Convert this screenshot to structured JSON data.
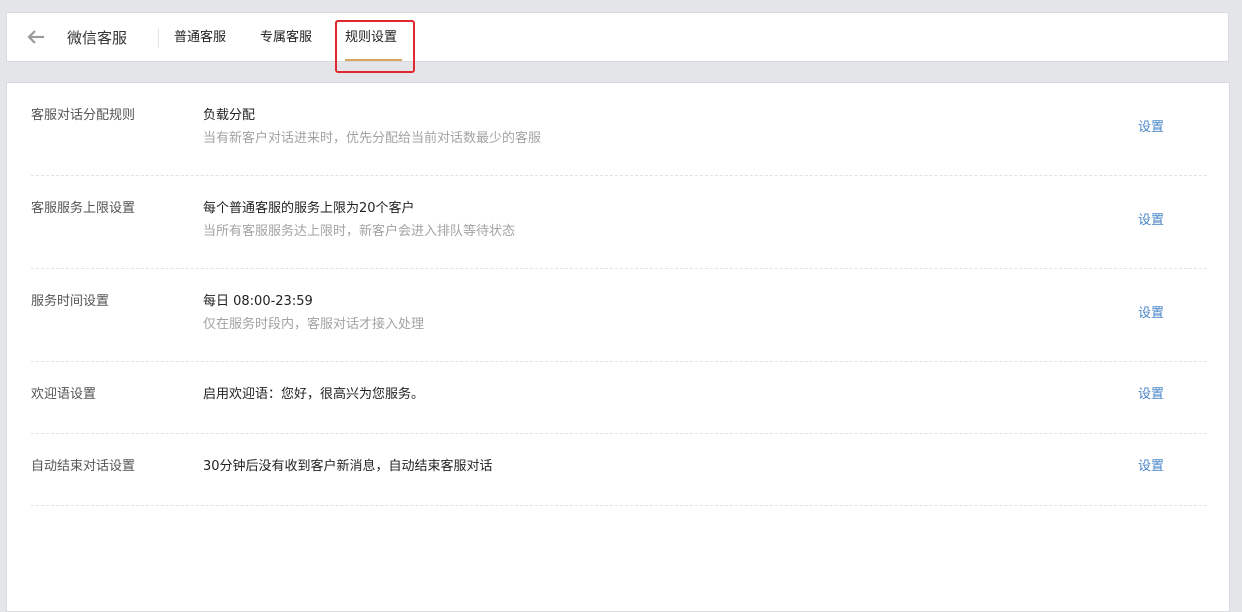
{
  "header": {
    "back_icon": "arrow-left-icon",
    "title": "微信客服",
    "tabs": [
      {
        "label": "普通客服",
        "active": false
      },
      {
        "label": "专属客服",
        "active": false
      },
      {
        "label": "规则设置",
        "active": true
      }
    ]
  },
  "colors": {
    "accent_underline": "#d9a55f",
    "link": "#4a86c7",
    "highlight_box": "#e0282e"
  },
  "rules": [
    {
      "label": "客服对话分配规则",
      "value": "负载分配",
      "description": "当有新客户对话进来时，优先分配给当前对话数最少的客服",
      "action": "设置"
    },
    {
      "label": "客服服务上限设置",
      "value": "每个普通客服的服务上限为20个客户",
      "description": "当所有客服服务达上限时，新客户会进入排队等待状态",
      "action": "设置"
    },
    {
      "label": "服务时间设置",
      "value": "每日 08:00-23:59",
      "description": "仅在服务时段内，客服对话才接入处理",
      "action": "设置"
    },
    {
      "label": "欢迎语设置",
      "value": "启用欢迎语：您好，很高兴为您服务。",
      "description": "",
      "action": "设置"
    },
    {
      "label": "自动结束对话设置",
      "value": "30分钟后没有收到客户新消息，自动结束客服对话",
      "description": "",
      "action": "设置"
    }
  ]
}
